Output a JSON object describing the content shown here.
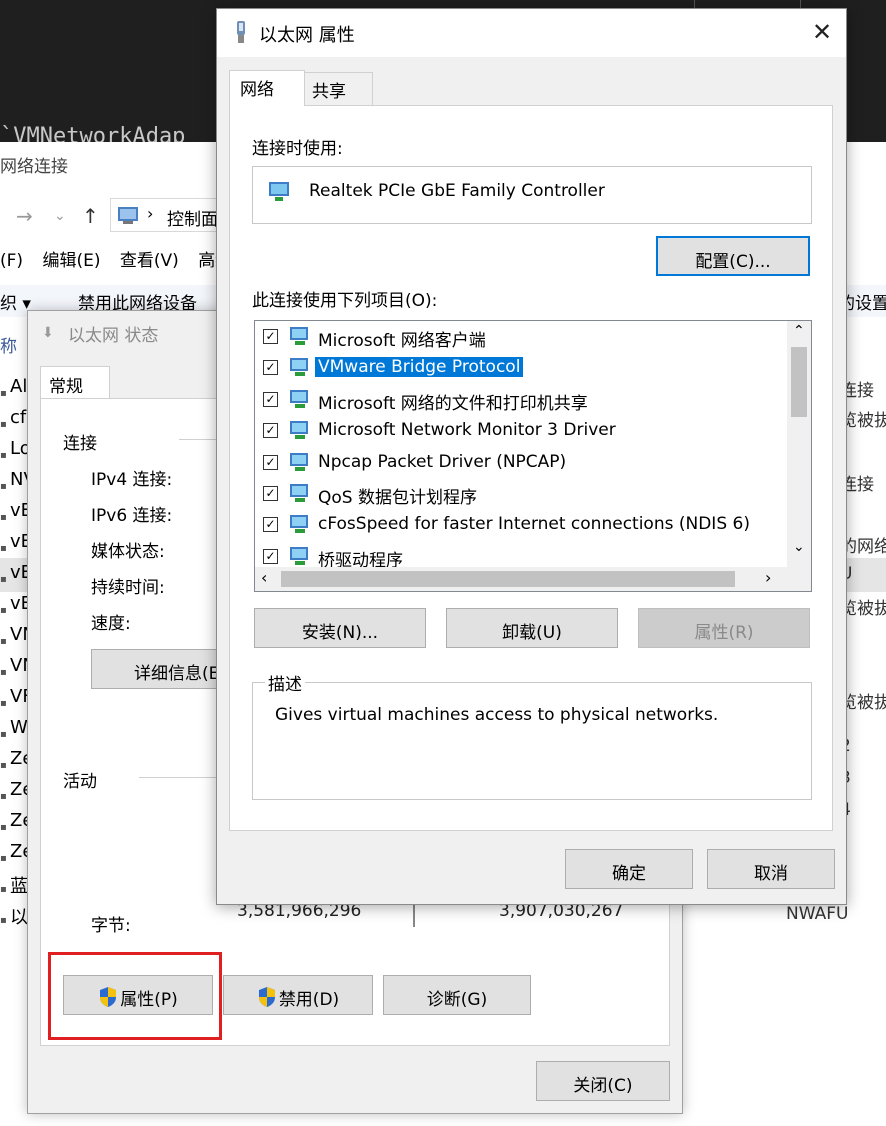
{
  "background": {
    "editor_text": "`VMNetworkAdap",
    "explorer": {
      "title": "网络连接",
      "address": "控制面",
      "menu": [
        "(F)",
        "编辑(E)",
        "查看(V)",
        "高级"
      ],
      "command_left": "织 ▾",
      "command_main": "禁用此网络设备",
      "command_right": "的设置",
      "column_header": "称",
      "rows": [
        "Al",
        "cf",
        "Lo",
        "NV",
        "vE",
        "vE",
        "vE",
        "vE",
        "VN",
        "VN",
        "VF",
        "W",
        "Ze",
        "Ze",
        "Ze",
        "Ze",
        "蓝",
        "以"
      ],
      "right_column": [
        "连接",
        "览被拔",
        "连接",
        "的网络",
        "U",
        "览被拔",
        "览被拔",
        "2",
        "3",
        "4"
      ],
      "nwafu": "NWAFU"
    }
  },
  "status_dialog": {
    "title": "以太网 状态",
    "tab": "常规",
    "connection_section": "连接",
    "fields": [
      "IPv4 连接:",
      "IPv6 连接:",
      "媒体状态:",
      "持续时间:",
      "速度:"
    ],
    "details_button": "详细信息(E",
    "activity_section": "活动",
    "bytes_label": "字节:",
    "bytes_sent": "3,581,966,296",
    "bytes_received": "3,907,030,267",
    "properties_button": "属性(P)",
    "disable_button": "禁用(D)",
    "diagnose_button": "诊断(G)",
    "close_button": "关闭(C)"
  },
  "properties_dialog": {
    "title": "以太网 属性",
    "tabs": [
      "网络",
      "共享"
    ],
    "connect_using_label": "连接时使用:",
    "adapter_name": "Realtek PCIe GbE Family Controller",
    "configure_button": "配置(C)...",
    "items_label": "此连接使用下列项目(O):",
    "items": [
      {
        "label": "Microsoft 网络客户端",
        "checked": true
      },
      {
        "label": "VMware Bridge Protocol",
        "checked": true,
        "selected": true
      },
      {
        "label": "Microsoft 网络的文件和打印机共享",
        "checked": true
      },
      {
        "label": "Microsoft Network Monitor 3 Driver",
        "checked": true
      },
      {
        "label": "Npcap Packet Driver (NPCAP)",
        "checked": true
      },
      {
        "label": "QoS 数据包计划程序",
        "checked": true
      },
      {
        "label": "cFosSpeed for faster Internet connections (NDIS 6)",
        "checked": true
      },
      {
        "label": "桥驱动程序",
        "checked": true
      }
    ],
    "install_button": "安装(N)...",
    "uninstall_button": "卸载(U)",
    "properties_button": "属性(R)",
    "description_label": "描述",
    "description_text": "Gives virtual machines access to physical networks.",
    "ok_button": "确定",
    "cancel_button": "取消"
  },
  "colors": {
    "selection": "#0078d7",
    "highlight_frame": "#e02020",
    "dialog_bg": "#f0f0f0"
  }
}
